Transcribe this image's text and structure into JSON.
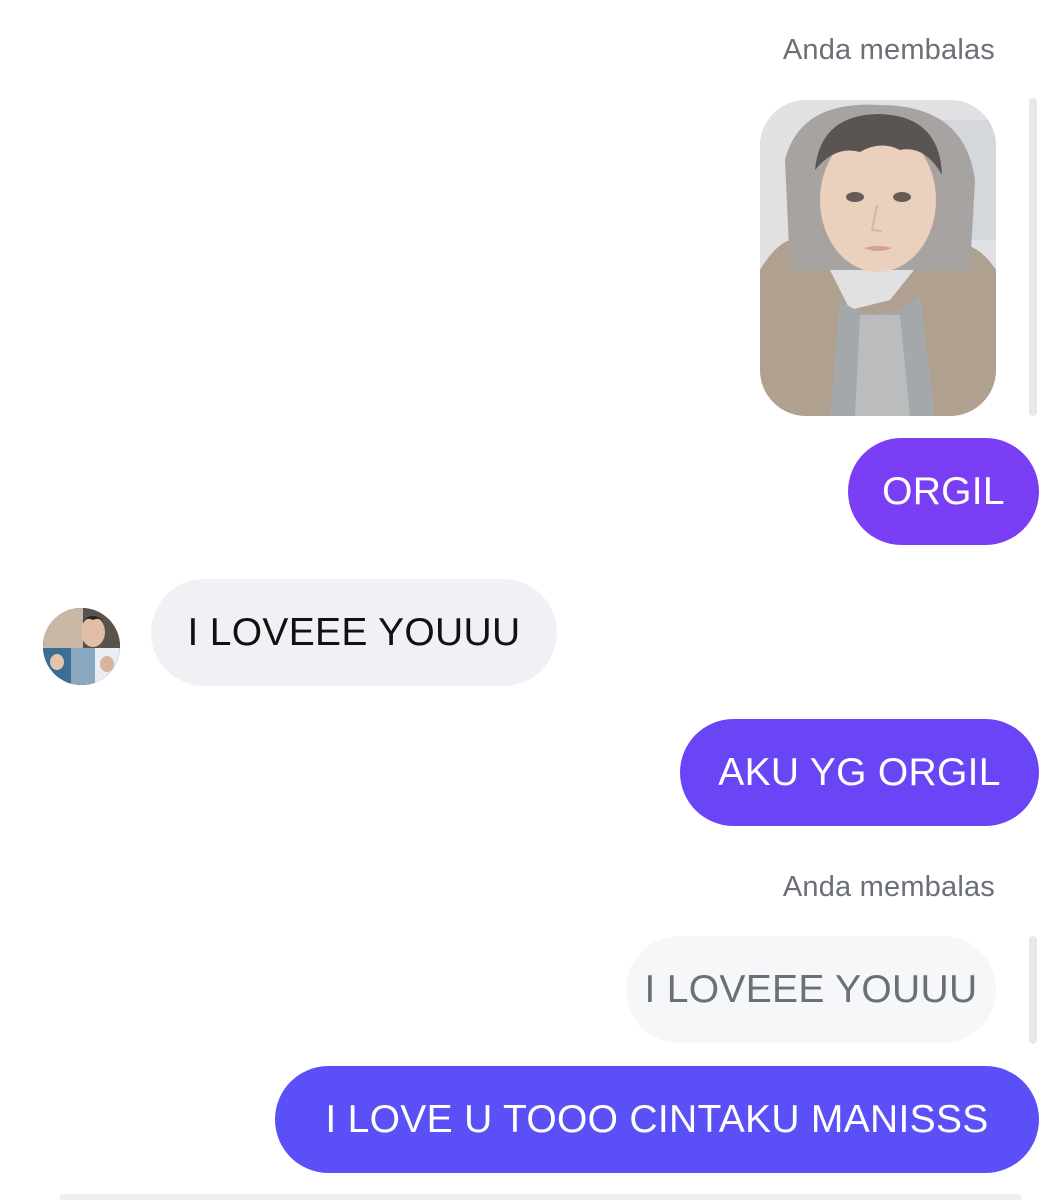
{
  "colors": {
    "sent_bubble_top": "#7a3ff5",
    "sent_bubble_mid": "#6a45f6",
    "sent_bubble_bottom": "#5b4ff7",
    "received_bubble": "#f0f1f4",
    "quoted_bubble": "#f6f7f9",
    "meta_text": "#6b6f76"
  },
  "messages": [
    {
      "type": "reply_label",
      "text": "Anda membalas"
    },
    {
      "type": "quoted_photo",
      "icon": "photo-thumbnail"
    },
    {
      "type": "sent",
      "text": "ORGIL"
    },
    {
      "type": "received",
      "text": "I LOVEEE YOUUU",
      "avatar": "contact-avatar"
    },
    {
      "type": "sent",
      "text": "AKU YG ORGIL"
    },
    {
      "type": "reply_label",
      "text": "Anda membalas"
    },
    {
      "type": "quoted_text",
      "text": "I LOVEEE YOUUU"
    },
    {
      "type": "sent",
      "text": "I LOVE U TOOO CINTAKU MANISSS"
    }
  ]
}
